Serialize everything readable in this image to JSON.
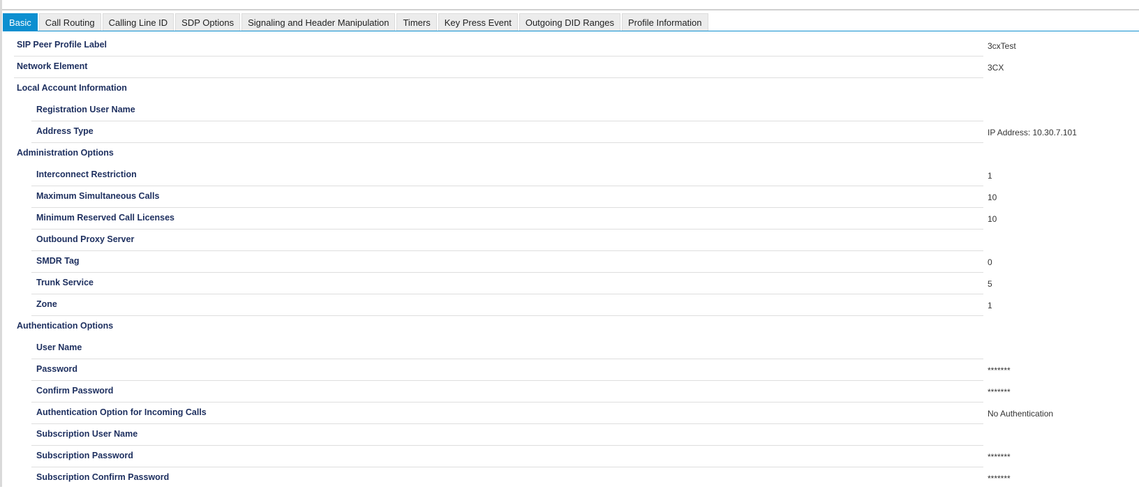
{
  "tabs": [
    {
      "label": "Basic",
      "active": true
    },
    {
      "label": "Call Routing",
      "active": false
    },
    {
      "label": "Calling Line ID",
      "active": false
    },
    {
      "label": "SDP Options",
      "active": false
    },
    {
      "label": "Signaling and Header Manipulation",
      "active": false
    },
    {
      "label": "Timers",
      "active": false
    },
    {
      "label": "Key Press Event",
      "active": false
    },
    {
      "label": "Outgoing DID Ranges",
      "active": false
    },
    {
      "label": "Profile Information",
      "active": false
    }
  ],
  "colors": {
    "accent": "#0d8fd0",
    "label": "#1d2f5f"
  },
  "rows": [
    {
      "label": "SIP Peer Profile Label",
      "value": "3cxTest",
      "level": "section",
      "rule": true
    },
    {
      "label": "Network Element",
      "value": "3CX",
      "level": "section",
      "rule": true
    },
    {
      "label": "Local Account Information",
      "value": "",
      "level": "section",
      "rule": false
    },
    {
      "label": "Registration User Name",
      "value": "",
      "level": "child",
      "rule": true
    },
    {
      "label": "Address Type",
      "value": "IP Address: 10.30.7.101",
      "level": "child",
      "rule": true
    },
    {
      "label": "Administration Options",
      "value": "",
      "level": "section",
      "rule": false
    },
    {
      "label": "Interconnect Restriction",
      "value": "1",
      "level": "child",
      "rule": true
    },
    {
      "label": "Maximum Simultaneous Calls",
      "value": "10",
      "level": "child",
      "rule": true
    },
    {
      "label": "Minimum Reserved Call Licenses",
      "value": "10",
      "level": "child",
      "rule": true
    },
    {
      "label": "Outbound Proxy Server",
      "value": "",
      "level": "child",
      "rule": true
    },
    {
      "label": "SMDR Tag",
      "value": "0",
      "level": "child",
      "rule": true
    },
    {
      "label": "Trunk Service",
      "value": "5",
      "level": "child",
      "rule": true
    },
    {
      "label": "Zone",
      "value": "1",
      "level": "child",
      "rule": true
    },
    {
      "label": "Authentication Options",
      "value": "",
      "level": "section",
      "rule": false
    },
    {
      "label": "User Name",
      "value": "",
      "level": "child",
      "rule": true
    },
    {
      "label": "Password",
      "value": "*******",
      "level": "child",
      "rule": true
    },
    {
      "label": "Confirm Password",
      "value": "*******",
      "level": "child",
      "rule": true
    },
    {
      "label": "Authentication Option for Incoming Calls",
      "value": "No Authentication",
      "level": "child",
      "rule": true
    },
    {
      "label": "Subscription User Name",
      "value": "",
      "level": "child",
      "rule": true
    },
    {
      "label": "Subscription Password",
      "value": "*******",
      "level": "child",
      "rule": true
    },
    {
      "label": "Subscription Confirm Password",
      "value": "*******",
      "level": "child",
      "rule": false
    }
  ]
}
